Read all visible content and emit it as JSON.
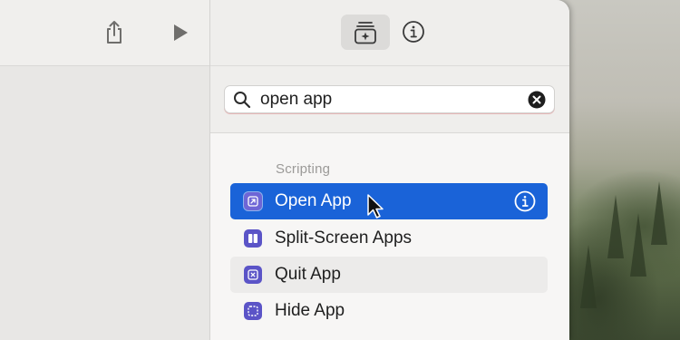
{
  "toolbar": {
    "left_icons": [
      "share-icon",
      "play-icon"
    ],
    "right_icons": [
      "library-icon",
      "info-icon"
    ]
  },
  "search": {
    "value": "open app",
    "icons": [
      "magnifier-icon",
      "clear-icon"
    ]
  },
  "actions": {
    "section_label": "Scripting",
    "items": [
      {
        "label": "Open App",
        "icon": "open-app-icon",
        "state": "selected"
      },
      {
        "label": "Split-Screen Apps",
        "icon": "split-screen-icon",
        "state": "normal"
      },
      {
        "label": "Quit App",
        "icon": "quit-app-icon",
        "state": "hover"
      },
      {
        "label": "Hide App",
        "icon": "hide-app-icon",
        "state": "normal"
      }
    ]
  },
  "colors": {
    "selection": "#1a63d8",
    "action_icon": "#5b54c7",
    "section_label": "#9b9a98"
  }
}
